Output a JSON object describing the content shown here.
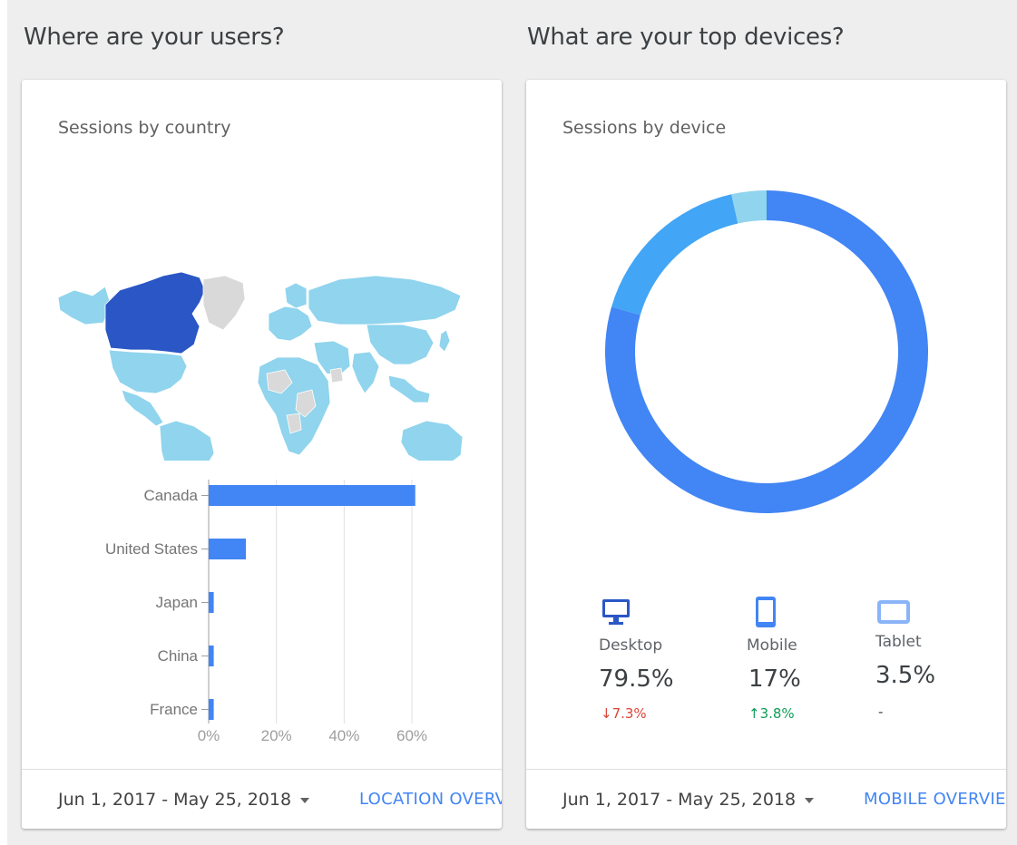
{
  "sections": {
    "users_title": "Where are your users?",
    "devices_title": "What are your top devices?"
  },
  "country_card": {
    "title": "Sessions by country",
    "date_range": "Jun 1, 2017 - May 25, 2018",
    "link_label": "LOCATION OVERVIEW"
  },
  "device_card": {
    "title": "Sessions by device",
    "date_range": "Jun 1, 2017 - May 25, 2018",
    "link_label": "MOBILE OVERVIEW",
    "devices": [
      {
        "name": "Desktop",
        "icon": "desktop-icon",
        "percent": "79.5%",
        "change": "7.3%",
        "arrow": "↓",
        "change_color": "#db4437"
      },
      {
        "name": "Mobile",
        "icon": "mobile-icon",
        "percent": "17%",
        "change": "3.8%",
        "arrow": "↑",
        "change_color": "#0f9d58"
      },
      {
        "name": "Tablet",
        "icon": "tablet-icon",
        "percent": "3.5%",
        "change": "-",
        "arrow": "",
        "change_color": "#3c4043"
      }
    ]
  },
  "chart_data": [
    {
      "type": "bar",
      "orientation": "horizontal",
      "categories": [
        "Canada",
        "United States",
        "Japan",
        "China",
        "France"
      ],
      "values": [
        61,
        11,
        1.5,
        1.5,
        1.5
      ],
      "xlim": [
        0,
        60
      ],
      "xticks": [
        "0%",
        "20%",
        "40%",
        "60%"
      ],
      "grid": true,
      "color": "#4285f4"
    },
    {
      "type": "pie",
      "style": "donut",
      "categories": [
        "Desktop",
        "Mobile",
        "Tablet"
      ],
      "values": [
        79.5,
        17,
        3.5
      ],
      "colors": [
        "#4285f4",
        "#42a5f5",
        "#90d4ee"
      ]
    }
  ],
  "map": {
    "highlight_color": "#2a56c6",
    "data_color": "#90d4ed",
    "nodata_color": "#d9d9d9"
  }
}
